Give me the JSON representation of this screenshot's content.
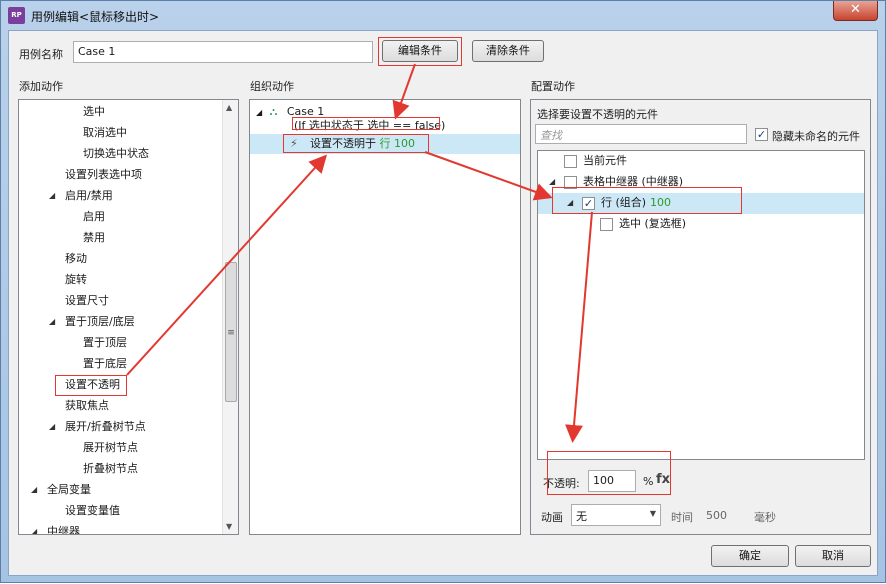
{
  "window": {
    "title": "用例编辑<鼠标移出时>",
    "app_icon": "RP",
    "close": "✕"
  },
  "case_name": {
    "label": "用例名称",
    "value": "Case 1"
  },
  "buttons": {
    "edit_condition": "编辑条件",
    "clear_condition": "清除条件",
    "ok": "确定",
    "cancel": "取消"
  },
  "sections": {
    "add_action": "添加动作",
    "organize_action": "组织动作",
    "configure_action": "配置动作"
  },
  "add_action_tree": [
    {
      "label": "选中",
      "expanded": null
    },
    {
      "label": "取消选中",
      "expanded": null
    },
    {
      "label": "切换选中状态",
      "expanded": null
    },
    {
      "label": "设置列表选中项",
      "expanded": null
    },
    {
      "label": "启用/禁用",
      "expanded": true
    },
    {
      "label": "启用",
      "expanded": null
    },
    {
      "label": "禁用",
      "expanded": null
    },
    {
      "label": "移动",
      "expanded": null
    },
    {
      "label": "旋转",
      "expanded": null
    },
    {
      "label": "设置尺寸",
      "expanded": null
    },
    {
      "label": "置于顶层/底层",
      "expanded": true
    },
    {
      "label": "置于顶层",
      "expanded": null
    },
    {
      "label": "置于底层",
      "expanded": null
    },
    {
      "label": "设置不透明",
      "expanded": null
    },
    {
      "label": "获取焦点",
      "expanded": null
    },
    {
      "label": "展开/折叠树节点",
      "expanded": true
    },
    {
      "label": "展开树节点",
      "expanded": null
    },
    {
      "label": "折叠树节点",
      "expanded": null
    },
    {
      "label": "全局变量",
      "expanded": true
    },
    {
      "label": "设置变量值",
      "expanded": null
    },
    {
      "label": "中继器",
      "expanded": true
    }
  ],
  "organize": {
    "case_label": "Case 1",
    "condition": "(If 选中状态于 选中 == false)",
    "action_prefix": "设置不透明于",
    "action_target": "行",
    "action_value": "100"
  },
  "configure": {
    "select_label": "选择要设置不透明的元件",
    "search_placeholder": "查找",
    "hide_unnamed_label": "隐藏未命名的元件",
    "hide_unnamed_checked": true,
    "tree": [
      {
        "label": "当前元件",
        "value": "",
        "checked": false,
        "expanded": null
      },
      {
        "label": "表格中继器 (中继器)",
        "value": "",
        "checked": false,
        "expanded": true
      },
      {
        "label": "行 (组合)",
        "value": "100",
        "checked": true,
        "expanded": true
      },
      {
        "label": "选中 (复选框)",
        "value": "",
        "checked": false,
        "expanded": null
      }
    ],
    "opacity_label": "不透明:",
    "opacity_value": "100",
    "opacity_unit": "%",
    "fx": "fx",
    "animation_label": "动画",
    "animation_value": "无",
    "time_label": "时间",
    "time_value": "500",
    "time_unit": "毫秒"
  },
  "colors": {
    "annotation_red": "#e3382f",
    "value_green": "#2b9a2b",
    "selection_blue": "#cce8f6"
  }
}
